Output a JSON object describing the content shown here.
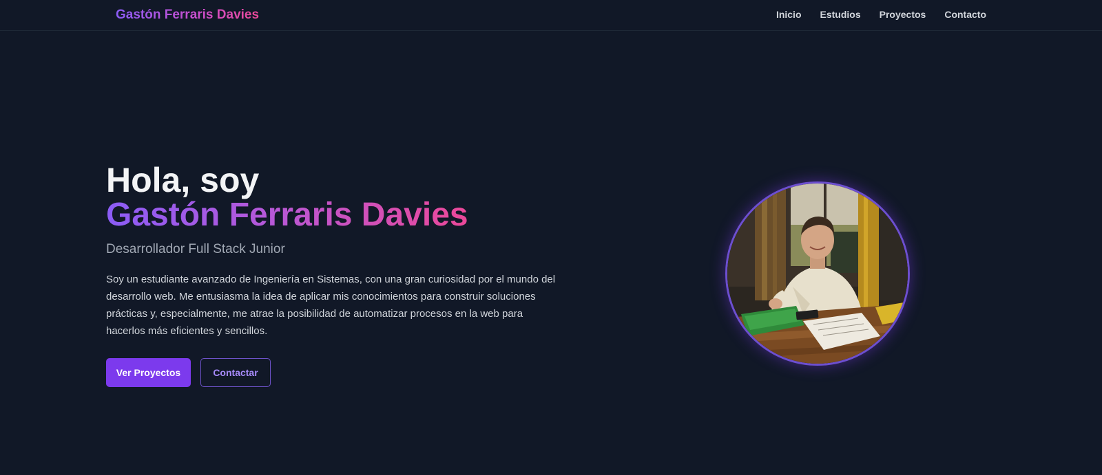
{
  "header": {
    "brand": "Gastón Ferraris Davies",
    "nav": [
      "Inicio",
      "Estudios",
      "Proyectos",
      "Contacto"
    ]
  },
  "hero": {
    "greeting": "Hola, soy",
    "name": "Gastón Ferraris Davies",
    "subtitle": "Desarrollador Full Stack Junior",
    "bio": "Soy un estudiante avanzado de Ingeniería en Sistemas, con una gran curiosidad por el mundo del desarrollo web. Me entusiasma la idea de aplicar mis conocimientos para construir soluciones prácticas y, especialmente, me atrae la posibilidad de automatizar procesos en la web para hacerlos más eficientes y sencillos.",
    "primary_button": "Ver Proyectos",
    "secondary_button": "Contactar"
  },
  "colors": {
    "background": "#111827",
    "accent": "#7c3aed",
    "gradient_start": "#8b5cf6",
    "gradient_end": "#ec4899"
  }
}
